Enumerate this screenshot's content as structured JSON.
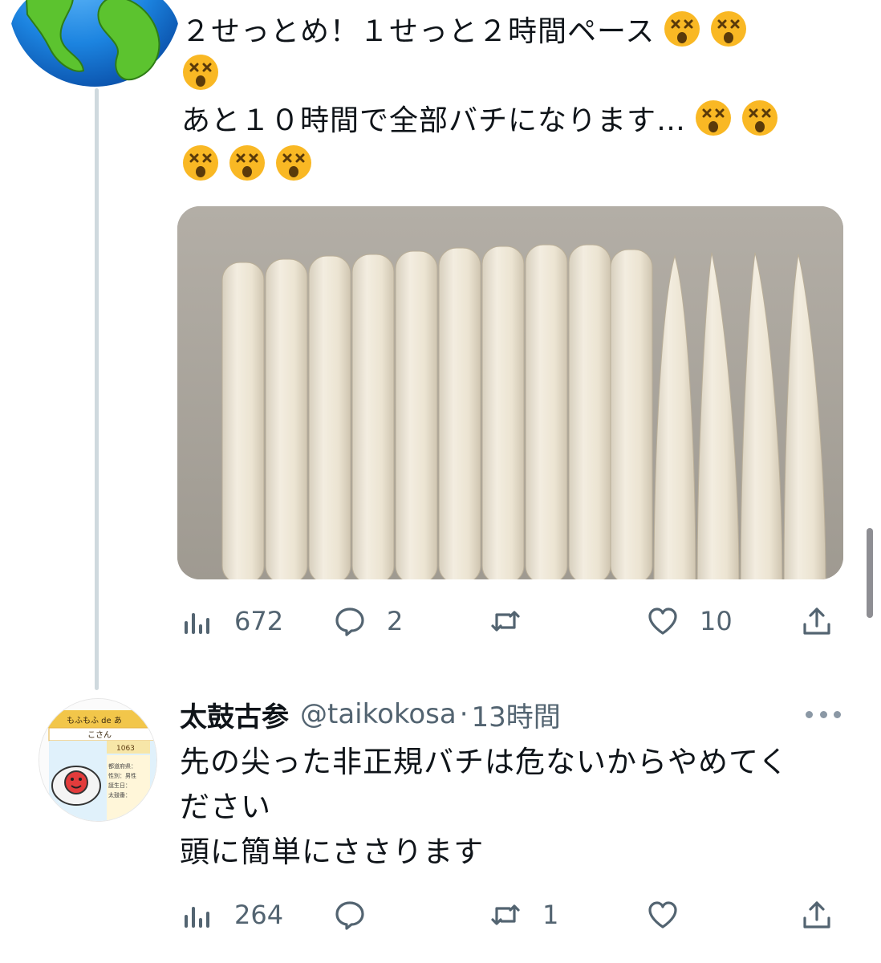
{
  "tweet1": {
    "lines": [
      "２せっとめ！１せっと２時間ペース",
      "",
      "あと１０時間で全部バチになります…",
      ""
    ],
    "stats": {
      "views": "672",
      "replies": "2",
      "retweets": "",
      "likes": "10"
    }
  },
  "tweet2": {
    "display_name": "太鼓古参",
    "handle": "@taikokosa",
    "separator": "·",
    "time": "13時間",
    "lines": [
      "先の尖った非正規バチは危ないからやめてく",
      "ださい",
      "頭に簡単にささります"
    ],
    "stats": {
      "views": "264",
      "replies": "",
      "retweets": "1",
      "likes": ""
    },
    "avatar_texts": [
      "もふもふ de あ",
      "こさん",
      "1063",
      "都道府県：",
      "性別：男性",
      "誕生日：",
      "太鼓番："
    ]
  },
  "icons": {
    "views": "views-icon",
    "reply": "reply-icon",
    "retweet": "retweet-icon",
    "like": "heart-icon",
    "share": "share-icon",
    "more": "more-icon",
    "emoji": "dizzy-face-emoji"
  },
  "colors": {
    "text": "#0f1419",
    "muted": "#536471",
    "thread": "#cfd9de",
    "emoji": "#f9b824"
  }
}
